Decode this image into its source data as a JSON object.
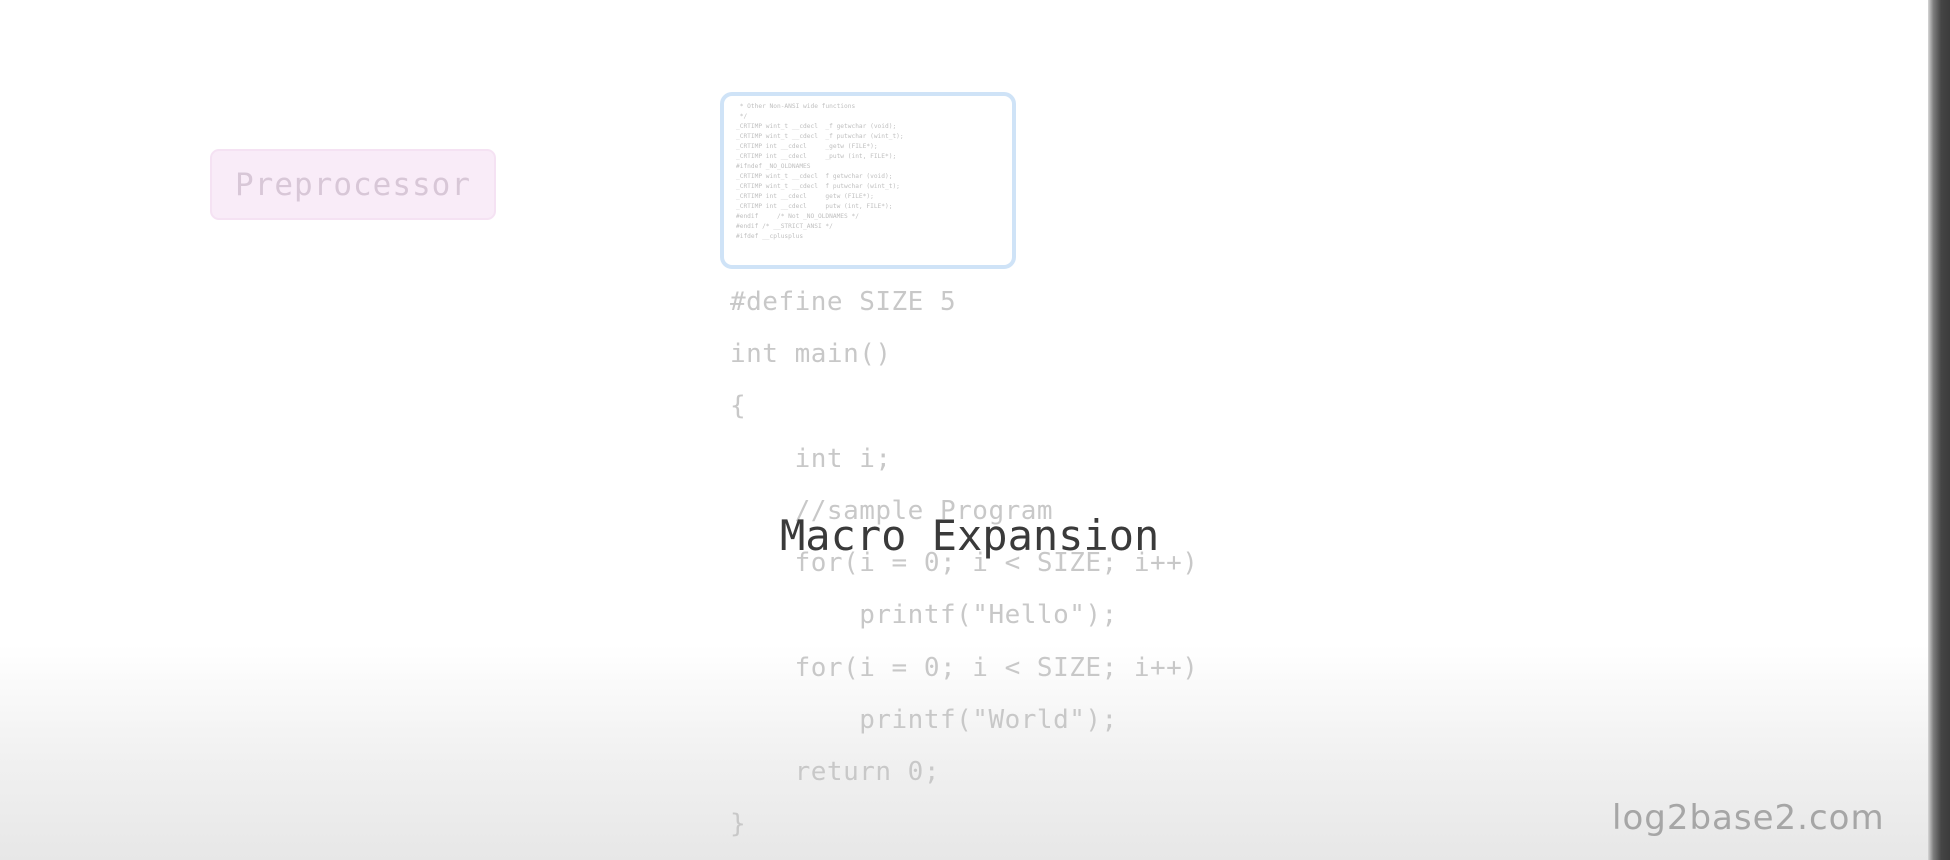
{
  "preprocessor_label": "Preprocessor",
  "header_thumbnail_lines": [
    " * Other Non-ANSI wide functions",
    " */",
    "_CRTIMP wint_t __cdecl  _f getwchar (void);",
    "_CRTIMP wint_t __cdecl  _f putwchar (wint_t);",
    "_CRTIMP int __cdecl     _getw (FILE*);",
    "_CRTIMP int __cdecl     _putw (int, FILE*);",
    "",
    "#ifndef _NO_OLDNAMES",
    "_CRTIMP wint_t __cdecl  f getwchar (void);",
    "_CRTIMP wint_t __cdecl  f putwchar (wint_t);",
    "_CRTIMP int __cdecl     getw (FILE*);",
    "_CRTIMP int __cdecl     putw (int, FILE*);",
    "#endif     /* Not _NO_OLDNAMES */",
    "",
    "#endif /* __STRICT_ANSI */",
    "",
    "#ifdef __cplusplus"
  ],
  "code_lines": [
    "#define SIZE 5",
    "int main()",
    "{",
    "    int i;",
    "    //sample Program",
    "    for(i = 0; i < SIZE; i++)",
    "        printf(\"Hello\");",
    "    for(i = 0; i < SIZE; i++)",
    "        printf(\"World\");",
    "    return 0;",
    "}"
  ],
  "macro_title": "Macro Expansion",
  "watermark": "log2base2.com"
}
